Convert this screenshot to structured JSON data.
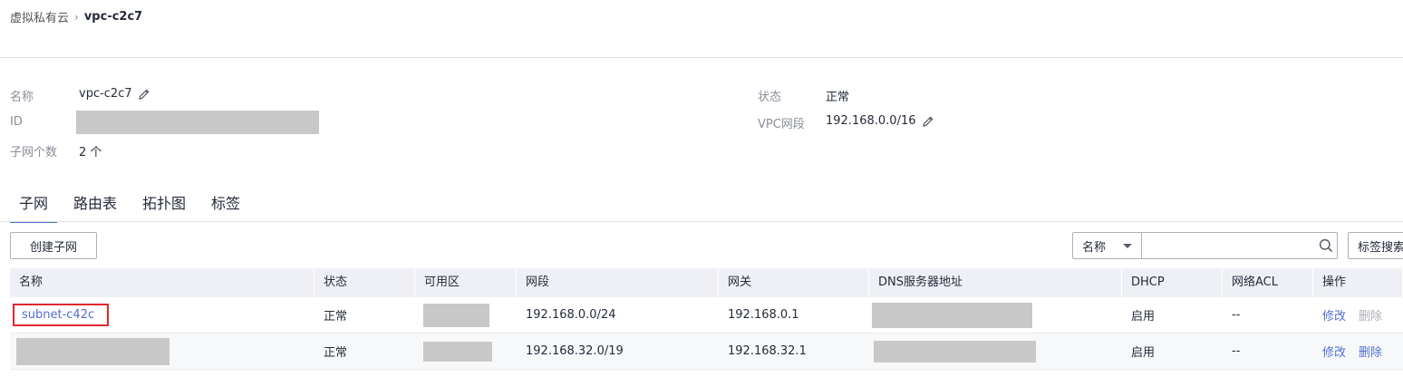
{
  "breadcrumb": {
    "parent": "虚拟私有云",
    "current": "vpc-c2c7"
  },
  "info": {
    "name_label": "名称",
    "name_value": "vpc-c2c7",
    "id_label": "ID",
    "subnet_count_label": "子网个数",
    "subnet_count_value": "2 个",
    "status_label": "状态",
    "status_value": "正常",
    "cidr_label": "VPC网段",
    "cidr_value": "192.168.0.0/16"
  },
  "tabs": [
    {
      "label": "子网",
      "active": true
    },
    {
      "label": "路由表",
      "active": false
    },
    {
      "label": "拓扑图",
      "active": false
    },
    {
      "label": "标签",
      "active": false
    }
  ],
  "toolbar": {
    "create_label": "创建子网",
    "search_field_selected": "名称",
    "search_placeholder": "",
    "tag_search_label": "标签搜索"
  },
  "table": {
    "headers": [
      "名称",
      "状态",
      "可用区",
      "网段",
      "网关",
      "DNS服务器地址",
      "DHCP",
      "网络ACL",
      "操作"
    ],
    "rows": [
      {
        "name": "subnet-c42c",
        "status": "正常",
        "cidr": "192.168.0.0/24",
        "gateway": "192.168.0.1",
        "dhcp": "启用",
        "acl": "--",
        "op_modify": "修改",
        "op_delete": "删除"
      },
      {
        "name": "",
        "status": "正常",
        "cidr": "192.168.32.0/19",
        "gateway": "192.168.32.1",
        "dhcp": "启用",
        "acl": "--",
        "op_modify": "修改",
        "op_delete": "删除"
      }
    ]
  },
  "colors": {
    "accent": "#526ecc",
    "highlight_border": "#e0282e",
    "mask": "#c8c8c8",
    "header_bg": "#eef0f5"
  },
  "icons": [
    "pencil-icon",
    "search-icon",
    "chevron-down-icon"
  ]
}
